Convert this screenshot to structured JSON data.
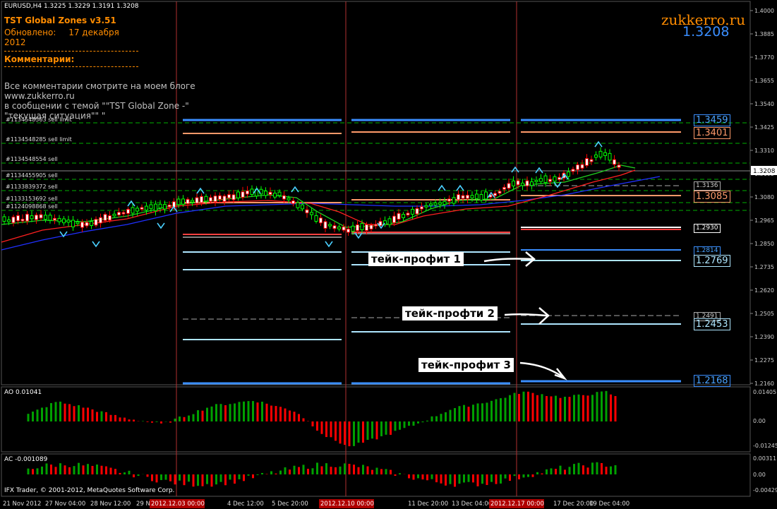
{
  "window": {
    "symbol_header": "EURUSD,H4  1.3225 1.3229 1.3191 1.3208"
  },
  "indicator_panel": {
    "title": "TST Global Zones  v3.51",
    "updated_label": "Обновлено:",
    "updated_date": "17 декабря 2012",
    "comments_heading": "Комментарии:",
    "comment_lines": [
      "Все комментарии смотрите на моем блоге",
      "www.zukkerro.ru",
      "в сообщении с темой \"\"TST Global Zone -\"",
      "\"текущая ситуация\"\" \""
    ]
  },
  "branding": {
    "site": "zukkerro.ru",
    "current_price": "1.3208"
  },
  "orders": [
    "#1134548563 sell limit",
    "#1134548285 sell limit",
    "#1134548554 sell",
    "#1134455905 sell",
    "#1133839372 sell",
    "#1133153692 sell",
    "#1124098868 sell"
  ],
  "annotations": {
    "tp1": "тейк-профит 1",
    "tp2": "тейк-профти 2",
    "tp3": "тейк-профит 3"
  },
  "level_labels": [
    {
      "text": "1.3459",
      "color": "#4aa3ff"
    },
    {
      "text": "1.3401",
      "color": "#ff9a6a"
    },
    {
      "text": "1.3136",
      "color": "#cccccc"
    },
    {
      "text": "1.3085",
      "color": "#ff9a6a"
    },
    {
      "text": "1.2930",
      "color": "#ffffff"
    },
    {
      "text": "1.2814",
      "color": "#4aa3ff"
    },
    {
      "text": "1.2769",
      "color": "#aee6ff"
    },
    {
      "text": "1.2491",
      "color": "#cccccc"
    },
    {
      "text": "1.2453",
      "color": "#aee6ff"
    },
    {
      "text": "1.2168",
      "color": "#4aa3ff"
    }
  ],
  "price_axis": {
    "ticks": [
      "1.4000",
      "1.3885",
      "1.3770",
      "1.3655",
      "1.3540",
      "1.3425",
      "1.3310",
      "1.3195",
      "1.3080",
      "1.2965",
      "1.2850",
      "1.2735",
      "1.2620",
      "1.2505",
      "1.2390",
      "1.2275",
      "1.2160"
    ],
    "current_label": "1.3208"
  },
  "ao_panel": {
    "label": "AO 0.01041",
    "axis_ticks": [
      "0.01405",
      "0.00",
      "-0.01245"
    ]
  },
  "ac_panel": {
    "label": "AC -0.001089",
    "axis_ticks": [
      "0.00311",
      "0.00",
      "-0.00429"
    ]
  },
  "copyright": "IFX Trader, © 2001-2012, MetaQuotes Software Corp.",
  "time_axis": {
    "ticks": [
      "21 Nov 2012",
      "27 Nov 04:00",
      "28 Nov 12:00",
      "29 N",
      "4 Dec 12:00",
      "5 Dec 20:00",
      "11 Dec 20:00",
      "13 Dec 04:00",
      "17 Dec 20:00",
      "19 Dec 04:00"
    ],
    "highlighted": [
      "2012.12.03 00:00",
      "2012.12.10 00:00",
      "2012.12.17 00:00"
    ]
  },
  "colors": {
    "background": "#000000",
    "bull_candle": "#00ff00",
    "bear_candle": "#ff0000",
    "grid_dash": "#00b000",
    "week_separator": "#b03030",
    "ao_up": "#00a000",
    "ao_down": "#ff0000",
    "panel_text_orange": "#ff8c00",
    "price_blue": "#3a8eff"
  }
}
